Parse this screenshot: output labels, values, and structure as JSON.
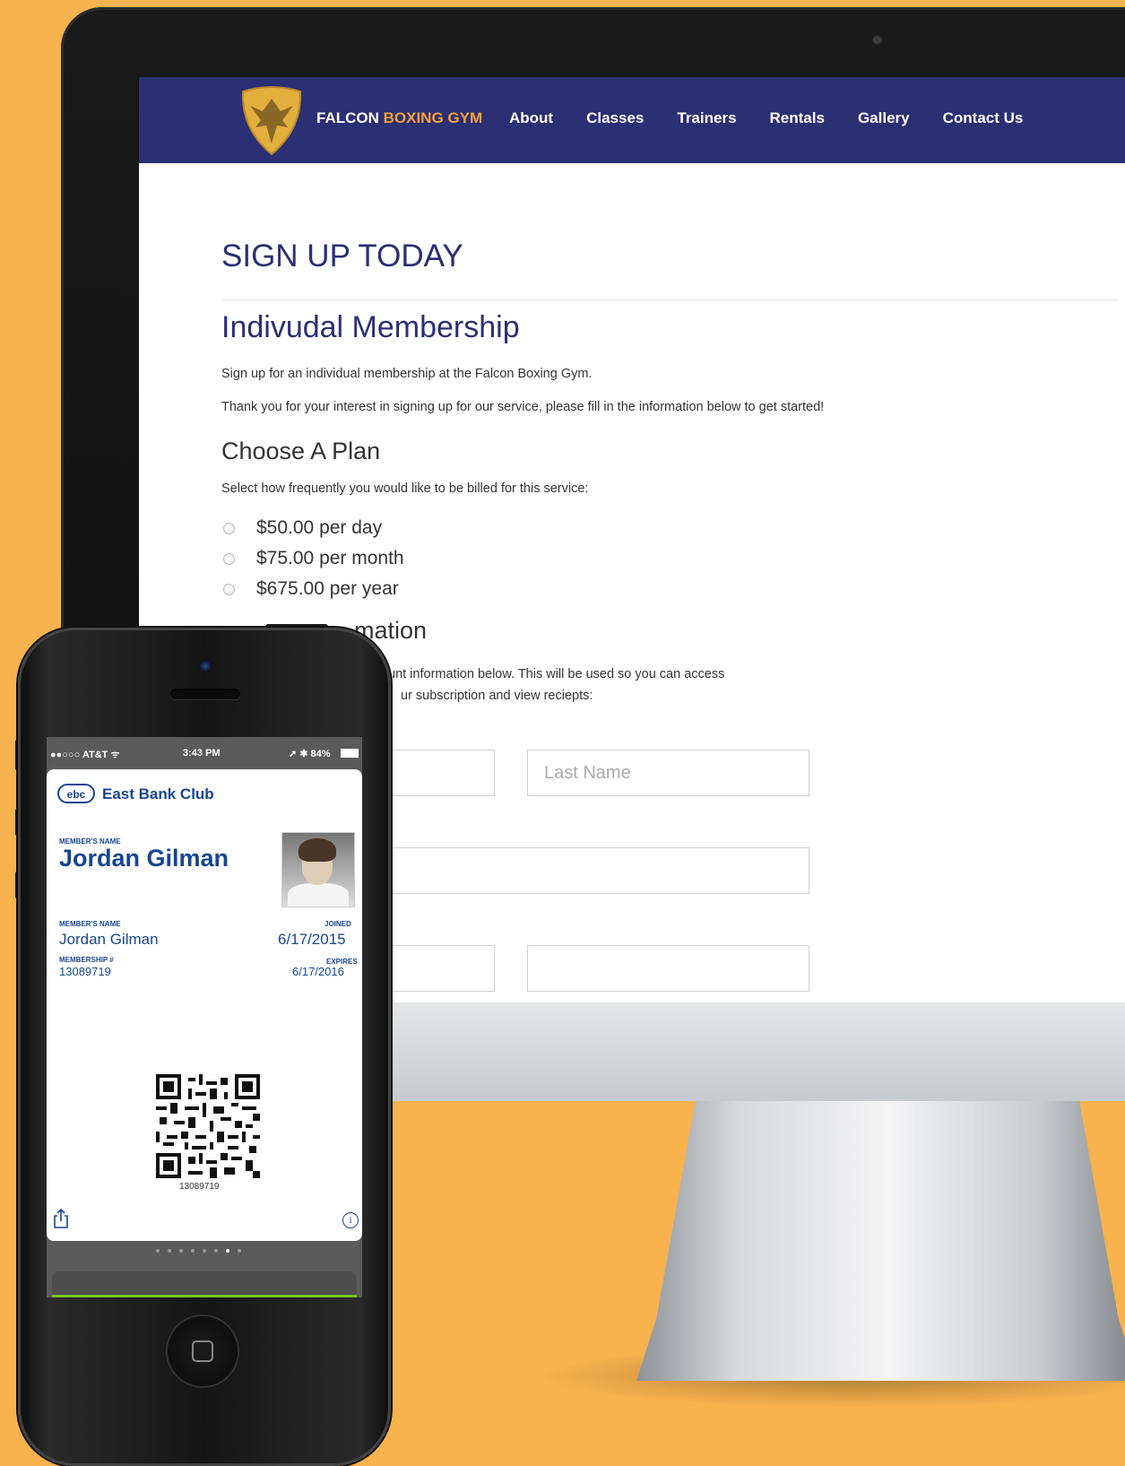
{
  "nav": {
    "brand_main": "FALCON",
    "brand_accent": "BOXING GYM",
    "links": [
      "About",
      "Classes",
      "Trainers",
      "Rentals",
      "Gallery",
      "Contact Us"
    ]
  },
  "page": {
    "title": "SIGN UP TODAY",
    "section_title": "Indivudal Membership",
    "intro_1": "Sign up for an individual membership at the Falcon Boxing Gym.",
    "intro_2": "Thank you for your interest in signing up for our service, please fill in the information below to get started!",
    "plan_title": "Choose A Plan",
    "plan_desc": "Select how frequently you would like to be billed for this service:",
    "plans": [
      "$50.00 per day",
      "$75.00 per month",
      "$675.00 per year"
    ],
    "account_title": "mation",
    "account_desc_line1": "unt information below. This will be used so you can access",
    "account_desc_line2": "ur subscription and view reciepts:",
    "fields": {
      "last_name_placeholder": "Last Name"
    }
  },
  "phone": {
    "status": {
      "carrier": "●●○○○ AT&T ᯤ",
      "time": "3:43 PM",
      "right": "➚ ✱ 84%"
    },
    "pass": {
      "logo_text": "ebc",
      "club_name": "East Bank Club",
      "member_name_label": "MEMBER'S NAME",
      "member_name": "Jordan Gilman",
      "member_name_label_2": "MEMBER'S NAME",
      "member_name_2": "Jordan Gilman",
      "joined_label": "JOINED",
      "joined": "6/17/2015",
      "membership_label": "MEMBERSHIP #",
      "membership_number": "13089719",
      "expires_label": "EXPIRES",
      "expires": "6/17/2016",
      "qr_number": "13089719"
    },
    "page_dots": 8,
    "active_dot": 6
  },
  "colors": {
    "background": "#f8b24e",
    "navbar": "#2b2f73",
    "accent": "#f2a23a",
    "pass_blue": "#17468f"
  }
}
